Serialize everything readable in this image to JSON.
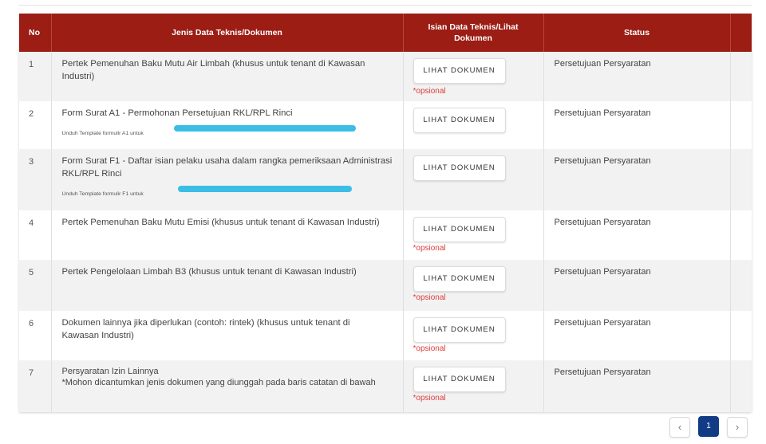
{
  "table": {
    "headers": {
      "no": "No",
      "jenis": "Jenis Data Teknis/Dokumen",
      "isian": "Isian Data Teknis/Lihat Dokumen",
      "status": "Status"
    },
    "rows": [
      {
        "no": "1",
        "title": "Pertek Pemenuhan Baku Mutu Air Limbah (khusus untuk tenant di Kawasan Industri)",
        "note": "",
        "button": "LIHAT DOKUMEN",
        "optional": "*opsional",
        "status": "Persetujuan Persyaratan"
      },
      {
        "no": "2",
        "title": "Form Surat A1 - Permohonan Persetujuan RKL/RPL Rinci",
        "note": "Unduh Template formulir A1 untuk",
        "button": "LIHAT DOKUMEN",
        "optional": "",
        "status": "Persetujuan Persyaratan"
      },
      {
        "no": "3",
        "title": "Form Surat F1 - Daftar isian pelaku usaha dalam rangka pemeriksaan Administrasi RKL/RPL Rinci",
        "note": "Unduh Template formulir F1 untuk",
        "button": "LIHAT DOKUMEN",
        "optional": "",
        "status": "Persetujuan Persyaratan"
      },
      {
        "no": "4",
        "title": "Pertek Pemenuhan Baku Mutu Emisi (khusus untuk tenant di Kawasan Industri)",
        "note": "",
        "button": "LIHAT DOKUMEN",
        "optional": "*opsional",
        "status": "Persetujuan Persyaratan"
      },
      {
        "no": "5",
        "title": "Pertek Pengelolaan Limbah B3 (khusus untuk tenant di Kawasan Industri)",
        "note": "",
        "button": "LIHAT DOKUMEN",
        "optional": "*opsional",
        "status": "Persetujuan Persyaratan"
      },
      {
        "no": "6",
        "title": "Dokumen lainnya jika diperlukan (contoh: rintek) (khusus untuk tenant di Kawasan Industri)",
        "note": "",
        "button": "LIHAT DOKUMEN",
        "optional": "*opsional",
        "status": "Persetujuan Persyaratan"
      },
      {
        "no": "7",
        "title": "Persyaratan Izin Lainnya",
        "title2": "*Mohon dicantumkan jenis dokumen yang diunggah pada baris catatan di bawah",
        "note": "",
        "button": "LIHAT DOKUMEN",
        "optional": "*opsional",
        "status": "Persetujuan Persyaratan"
      }
    ]
  },
  "pagination": {
    "prev_icon": "chevron-left-icon",
    "next_icon": "chevron-right-icon",
    "prev": "‹",
    "current": "1",
    "next": "›"
  },
  "colors": {
    "header_bg": "#9b1d14",
    "optional_text": "#e03a3a",
    "active_page": "#123b85",
    "redaction": "#3cbde6"
  }
}
